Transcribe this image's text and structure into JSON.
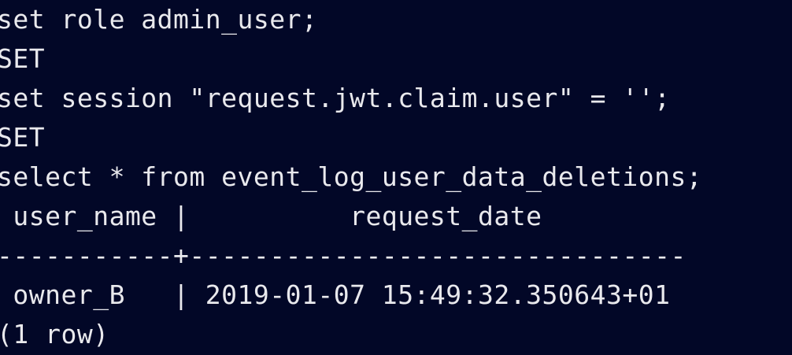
{
  "terminal": {
    "lines": [
      "set role admin_user;",
      "SET",
      "set session \"request.jwt.claim.user\" = '';",
      "SET",
      "select * from event_log_user_data_deletions;",
      " user_name |          request_date",
      "-----------+-------------------------------",
      " owner_B   | 2019-01-07 15:49:32.350643+01",
      "(1 row)"
    ]
  }
}
